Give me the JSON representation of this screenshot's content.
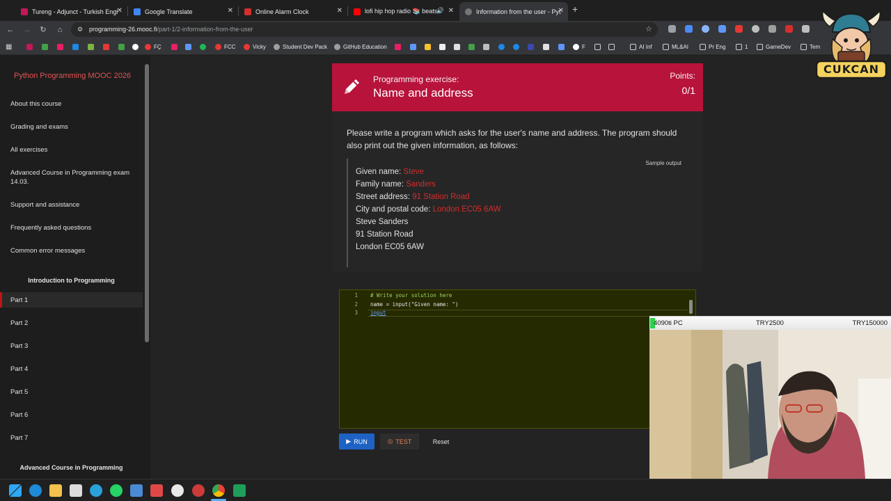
{
  "tabs": [
    {
      "label": "Tureng - Adjunct - Turkish Engl",
      "color": "#c2185b"
    },
    {
      "label": "Google Translate",
      "color": "#4285f4"
    },
    {
      "label": "Online Alarm Clock",
      "color": "#d32f2f"
    },
    {
      "label": "lofi hip hop radio 📚 beats t",
      "color": "#ff0000"
    },
    {
      "label": "Information from the user - Pyt",
      "color": "#616161"
    }
  ],
  "url": {
    "host": "programming-26.mooc.fi",
    "path": "/part-1/2-information-from-the-user"
  },
  "bookmarks": [
    "FÇ",
    "FCC",
    "Vicky",
    "Student Dev Pack",
    "GitHub Education",
    "F",
    "AI Inf",
    "ML&AI",
    "Pr Eng",
    "1",
    "GameDev",
    "Tem"
  ],
  "sidebar": {
    "course_title": "Python Programming MOOC 2026",
    "links": [
      "About this course",
      "Grading and exams",
      "All exercises",
      "Advanced Course in Programming exam",
      "14.03.",
      "Support and assistance",
      "Frequently asked questions",
      "Common error messages"
    ],
    "section1": "Introduction to Programming",
    "parts": [
      "Part 1",
      "Part 2",
      "Part 3",
      "Part 4",
      "Part 5",
      "Part 6",
      "Part 7"
    ],
    "section2": "Advanced Course in Programming"
  },
  "exercise": {
    "kicker": "Programming exercise:",
    "title": "Name and address",
    "points_label": "Points:",
    "points_value": "0/1",
    "prompt": "Please write a program which asks for the user's name and address. The program should also print out the given information, as follows:",
    "sample_label": "Sample output",
    "sample": [
      {
        "prefix": "Given name: ",
        "value": "Steve"
      },
      {
        "prefix": "Family name: ",
        "value": "Sanders"
      },
      {
        "prefix": "Street address: ",
        "value": "91 Station Road"
      },
      {
        "prefix": "City and postal code: ",
        "value": "London EC05 6AW"
      },
      {
        "prefix": "Steve Sanders",
        "value": ""
      },
      {
        "prefix": "91 Station Road",
        "value": ""
      },
      {
        "prefix": "London EC05 6AW",
        "value": ""
      }
    ]
  },
  "editor": {
    "lines": [
      {
        "num": "1",
        "text": "# Write your solution here",
        "color": "#9fd36a"
      },
      {
        "num": "2",
        "text": "name = input(\"Given name: \")",
        "color": "#e8e8e8"
      },
      {
        "num": "3",
        "text": "input",
        "color": "#6aa6ff"
      }
    ]
  },
  "buttons": {
    "run": "RUN",
    "test": "TEST",
    "reset": "Reset"
  },
  "overlay": {
    "gpu_label": "4090ti PC",
    "price1": "TRY2500",
    "price2": "TRY150000",
    "progress_fraction": 0.02
  },
  "mascot_text": "CUKCAN"
}
